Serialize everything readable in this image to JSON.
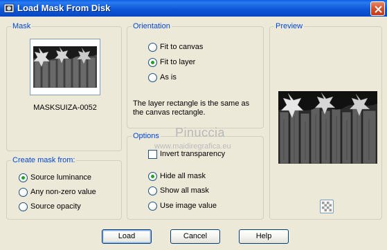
{
  "window": {
    "title": "Load Mask From Disk"
  },
  "mask_group": {
    "legend": "Mask",
    "file_name": "MASKSUIZA-0052"
  },
  "orientation": {
    "legend": "Orientation",
    "options": [
      {
        "label": "Fit to canvas",
        "checked": false
      },
      {
        "label": "Fit to layer",
        "checked": true
      },
      {
        "label": "As is",
        "checked": false
      }
    ],
    "description": "The layer rectangle is the same as the canvas rectangle."
  },
  "preview": {
    "legend": "Preview"
  },
  "create_mask": {
    "legend": "Create mask from:",
    "options": [
      {
        "label": "Source luminance",
        "checked": true
      },
      {
        "label": "Any non-zero value",
        "checked": false
      },
      {
        "label": "Source opacity",
        "checked": false
      }
    ]
  },
  "options_group": {
    "legend": "Options",
    "invert_label": "Invert transparency",
    "invert_checked": false,
    "options": [
      {
        "label": "Hide all mask",
        "checked": true
      },
      {
        "label": "Show all mask",
        "checked": false
      },
      {
        "label": "Use image value",
        "checked": false
      }
    ]
  },
  "watermark": {
    "name": "Pinuccia",
    "site": "www.maidiregrafica.eu"
  },
  "buttons": {
    "load": "Load",
    "cancel": "Cancel",
    "help": "Help"
  },
  "icons": {
    "app": "mask-app-icon",
    "close": "close-icon",
    "preview_toggle": "checker-icon"
  },
  "colors": {
    "title_bar": "#0A5FE4",
    "legend_text": "#0046D5",
    "dialog_bg": "#ECE9D8",
    "radio_checked": "#21A121"
  }
}
